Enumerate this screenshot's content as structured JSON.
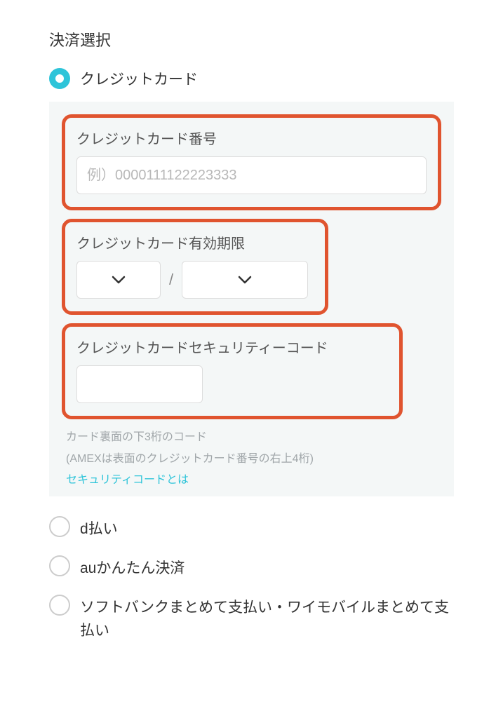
{
  "section": {
    "title": "決済選択"
  },
  "payment_options": {
    "credit_card": {
      "label": "クレジットカード",
      "selected": true
    },
    "d_barai": {
      "label": "d払い"
    },
    "au": {
      "label": "auかんたん決済"
    },
    "softbank": {
      "label": "ソフトバンクまとめて支払い・ワイモバイルまとめて支払い"
    }
  },
  "card_form": {
    "number": {
      "label": "クレジットカード番号",
      "placeholder": "例）0000111122223333",
      "value": ""
    },
    "expiry": {
      "label": "クレジットカード有効期限",
      "separator": "/"
    },
    "security": {
      "label": "クレジットカードセキュリティーコード",
      "hint_line1": "カード裏面の下3桁のコード",
      "hint_line2": "(AMEXは表面のクレジットカード番号の右上4桁)",
      "link_text": "セキュリティコードとは"
    }
  }
}
